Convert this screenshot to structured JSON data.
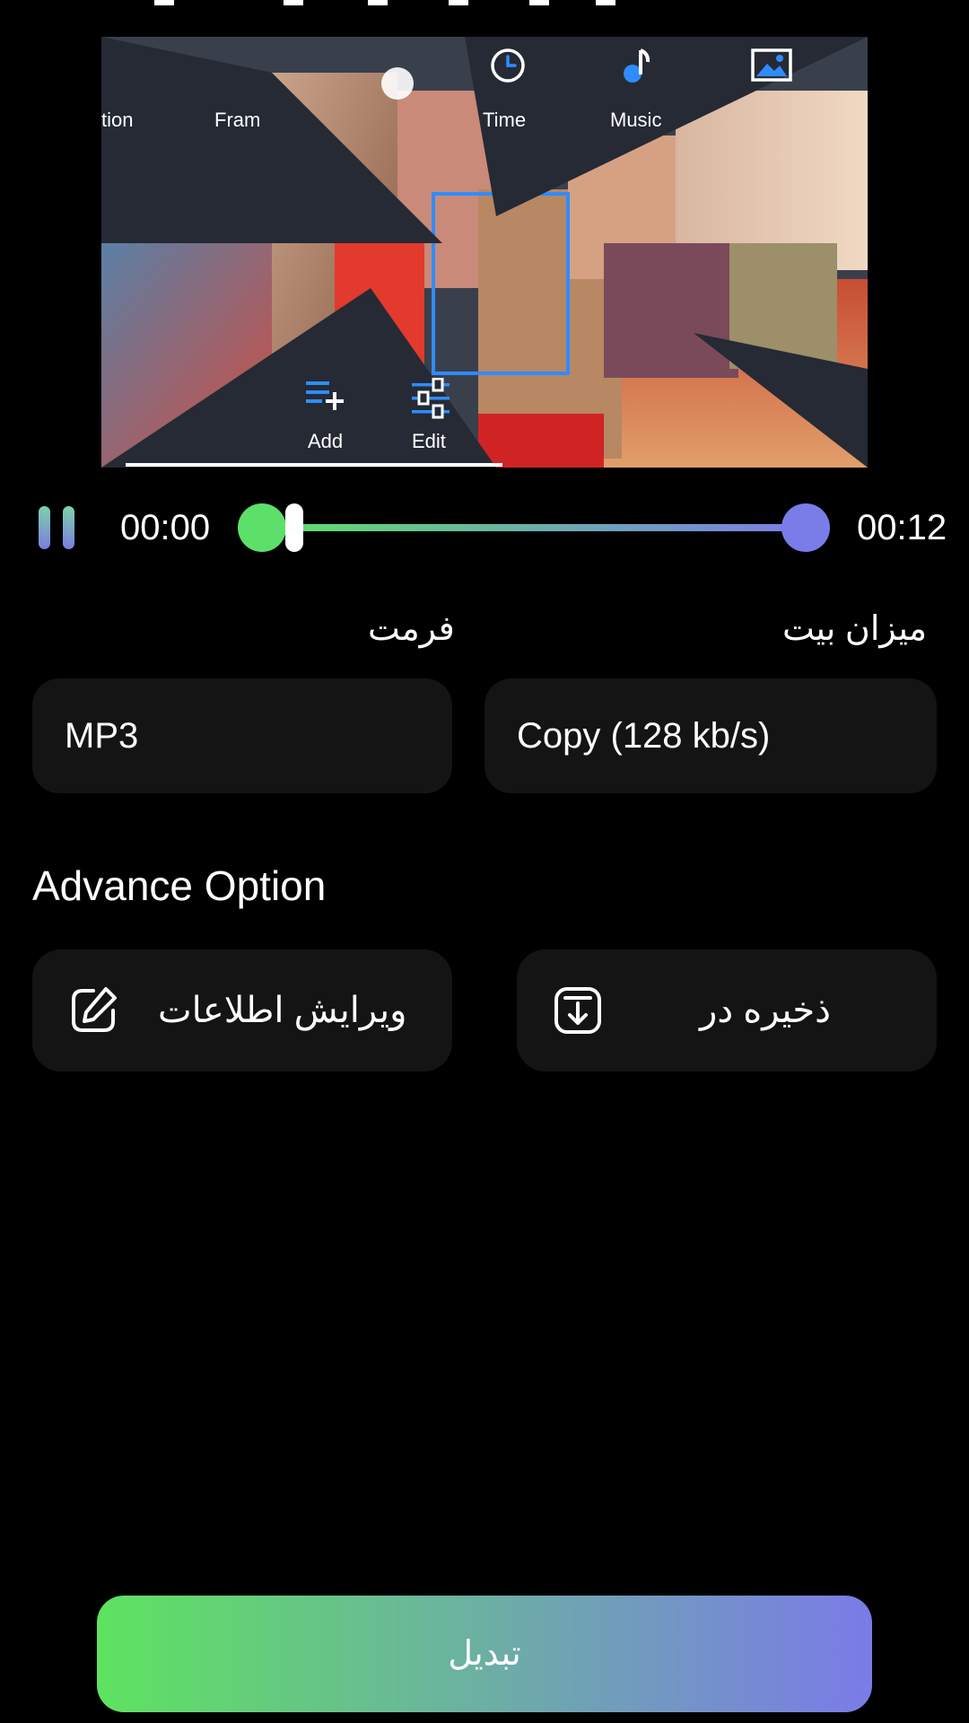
{
  "preview": {
    "menu_items": {
      "transition_partial": "tion",
      "frame_partial": "Fram",
      "time": "Time",
      "music": "Music",
      "add": "Add",
      "edit": "Edit"
    },
    "icons": [
      "clock-icon",
      "music-note-icon",
      "image-icon",
      "add-list-icon",
      "sliders-icon"
    ],
    "accent": "#2f8cff"
  },
  "player": {
    "start_time": "00:00",
    "end_time": "00:12",
    "state": "playing"
  },
  "form": {
    "format_label": "فرمت",
    "format_value": "MP3",
    "bitrate_label": "میزان بیت",
    "bitrate_value": "Copy (128 kb/s)"
  },
  "advanced": {
    "title": "Advance Option",
    "edit_info_label": "ویرایش اطلاعات",
    "save_to_label": "ذخیره در"
  },
  "convert_button": "تبدیل",
  "colors": {
    "gradient_start": "#5de06a",
    "gradient_end": "#7a7de8",
    "card_bg": "#141414",
    "background": "#000000"
  }
}
